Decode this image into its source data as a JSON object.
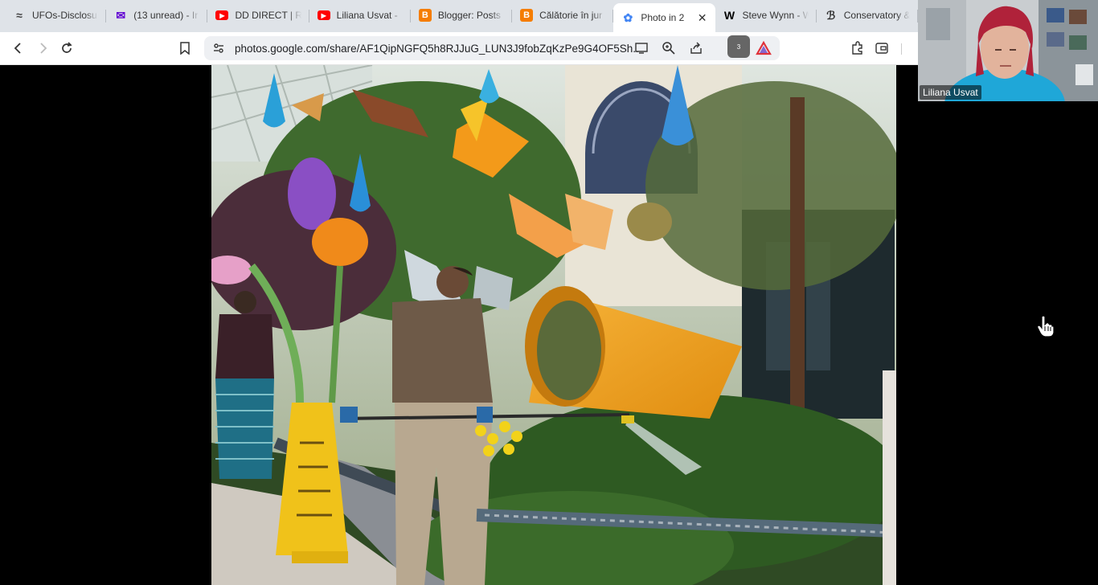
{
  "tabs": [
    {
      "label": "UFOs-Disclosu",
      "icon": "ufo-site-icon",
      "icon_color": "#444444",
      "active": false
    },
    {
      "label": "(13 unread) - Ir",
      "icon": "yahoo-mail-icon",
      "icon_color": "#6001d2",
      "active": false
    },
    {
      "label": "DD DIRECT | Ra",
      "icon": "youtube-icon",
      "icon_color": "#ff0000",
      "active": false
    },
    {
      "label": "Liliana Usvat -",
      "icon": "youtube-icon",
      "icon_color": "#ff0000",
      "active": false
    },
    {
      "label": "Blogger: Posts",
      "icon": "blogger-icon",
      "icon_color": "#f57d00",
      "active": false
    },
    {
      "label": "Călătorie în jur",
      "icon": "blogger-icon",
      "icon_color": "#f57d00",
      "active": false
    },
    {
      "label": "Photo in 2",
      "icon": "google-photos-icon",
      "icon_color": "#4285f4",
      "active": true
    },
    {
      "label": "Steve Wynn - W",
      "icon": "wikipedia-icon",
      "icon_color": "#000000",
      "active": false
    },
    {
      "label": "Conservatory &",
      "icon": "conservatory-icon",
      "icon_color": "#333333",
      "active": false
    }
  ],
  "toolbar": {
    "url": "photos.google.com/share/AF1QipNGFQ5h8RJJuG_LUN3J9fobZqKzPe9G4OF5Sh...",
    "brave_badge": "3"
  },
  "video": {
    "participant_name": "Liliana Usvat"
  },
  "colors": {
    "tabstrip_bg": "#dfe3e8",
    "toolbar_bg": "#ffffff",
    "omnibox_bg": "#eef0f3",
    "page_bg": "#000000",
    "pot_orange": "#f0a020"
  }
}
